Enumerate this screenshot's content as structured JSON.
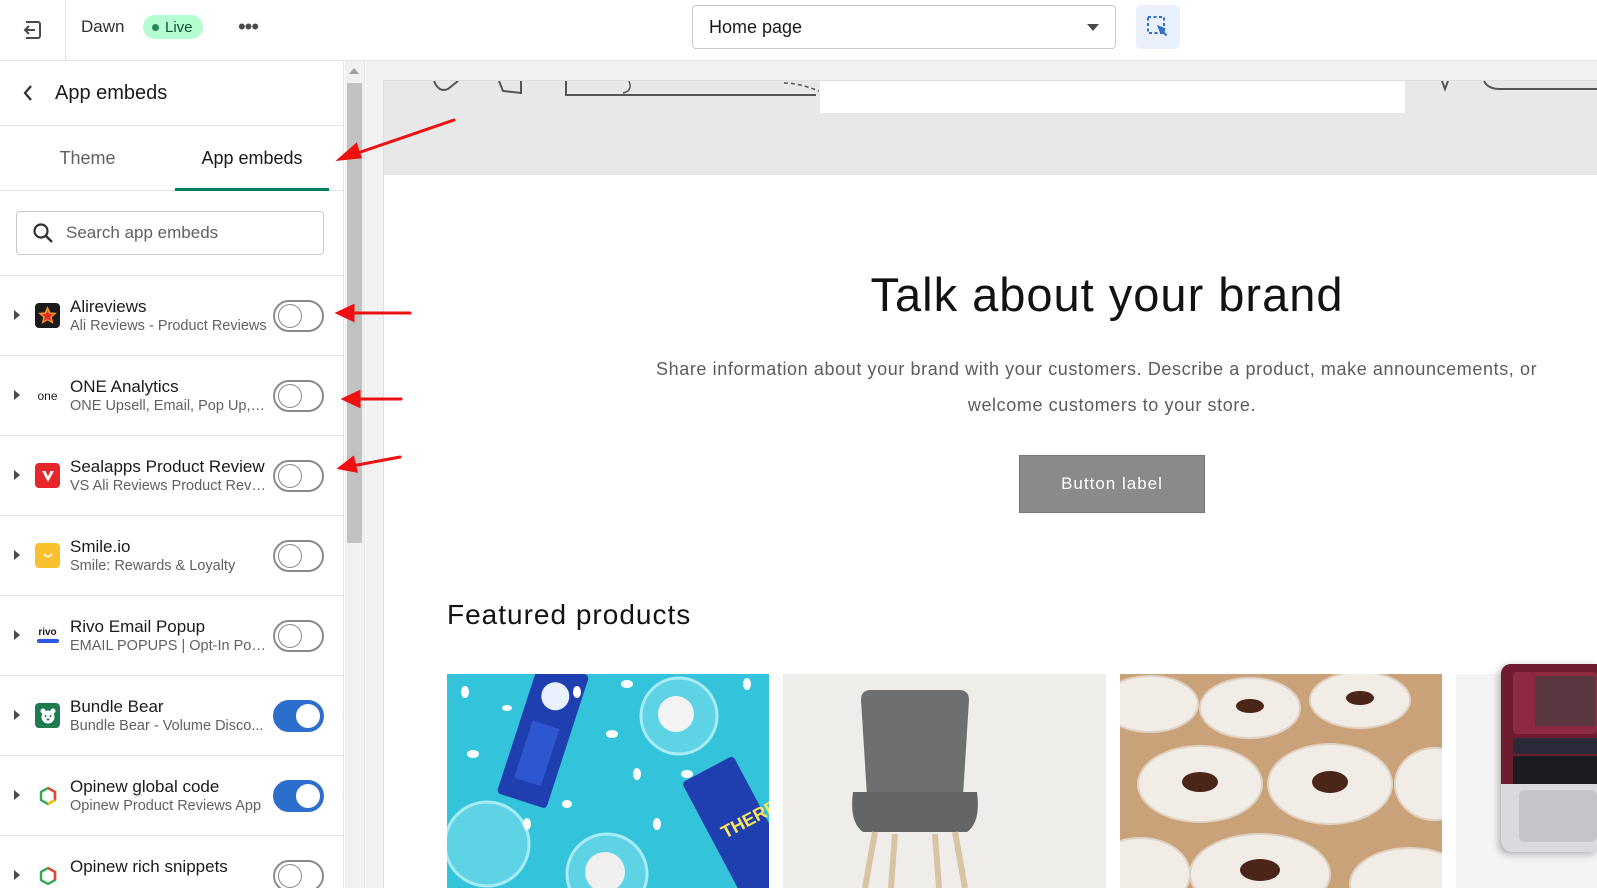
{
  "topbar": {
    "theme_name": "Dawn",
    "status_badge": "Live",
    "more_label": "•••",
    "page_selector": "Home page"
  },
  "sidebar": {
    "title": "App embeds",
    "tabs": [
      {
        "label": "Theme",
        "active": false
      },
      {
        "label": "App embeds",
        "active": true
      }
    ],
    "search": {
      "placeholder": "Search app embeds",
      "value": ""
    },
    "embeds": [
      {
        "name": "Alireviews",
        "subtitle": "Ali Reviews - Product Reviews",
        "enabled": false,
        "icon": "alireviews-star-icon",
        "icon_color": "#f15a24",
        "icon_text": "★"
      },
      {
        "name": "ONE Analytics",
        "subtitle": "ONE Upsell, Email, Pop Up, S...",
        "enabled": false,
        "icon": "one-logo-icon",
        "icon_color": "#ffffff",
        "icon_text": "one"
      },
      {
        "name": "Sealapps Product Review",
        "subtitle": "VS Ali Reviews Product Revie...",
        "enabled": false,
        "icon": "sealapps-v-icon",
        "icon_color": "#e8242c",
        "icon_text": "V"
      },
      {
        "name": "Smile.io",
        "subtitle": "Smile: Rewards & Loyalty",
        "enabled": false,
        "icon": "smile-icon",
        "icon_color": "#fbc02d",
        "icon_text": "◡"
      },
      {
        "name": "Rivo Email Popup",
        "subtitle": "EMAIL POPUPS | Opt-In Pop ...",
        "enabled": false,
        "icon": "rivo-logo-icon",
        "icon_color": "#ffffff",
        "icon_text": "rivo"
      },
      {
        "name": "Bundle Bear",
        "subtitle": "Bundle Bear - Volume Disco...",
        "enabled": true,
        "icon": "bear-icon",
        "icon_color": "#1e7a4f",
        "icon_text": "ʕ•"
      },
      {
        "name": "Opinew global code",
        "subtitle": "Opinew Product Reviews App",
        "enabled": true,
        "icon": "opinew-hexagon-icon",
        "icon_color": "#ffffff",
        "icon_text": "⬡"
      },
      {
        "name": "Opinew rich snippets",
        "subtitle": "",
        "enabled": false,
        "icon": "opinew-hexagon-icon",
        "icon_color": "#ffffff",
        "icon_text": "⬡"
      }
    ]
  },
  "preview": {
    "heading": "Talk about your brand",
    "text_line1": "Share information about your brand with your customers. Describe a product, make announcements, or",
    "text_line2": "welcome customers to your store.",
    "button_label": "Button label",
    "featured_title": "Featured products"
  },
  "colors": {
    "accent_blue": "#2c6ecb",
    "tab_underline": "#008060",
    "live_badge_bg": "#b4fed2",
    "annotation_red": "#ee1111"
  }
}
